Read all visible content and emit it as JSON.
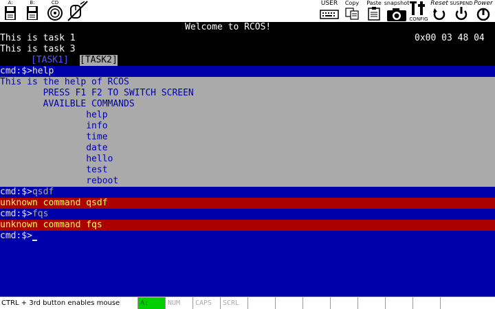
{
  "toolbar": {
    "drive_a_label": "A:",
    "drive_b_label": "B:",
    "cdrom_label": "CD",
    "user_label": "USER",
    "copy_label": "Copy",
    "paste_label": "Paste",
    "snapshot_label": "snapshot",
    "config_label": "CONFIG",
    "reset_label": "Reset",
    "suspend_label": "SUSPEND",
    "power_label": "Power"
  },
  "screen": {
    "title": "Welcome to RCOS!",
    "task1": "This is task 1",
    "task3": "This is task 3",
    "clock": "0x00 03 48 04",
    "tabs": [
      "[TASK1]",
      "[TASK2]"
    ],
    "prompt": "cmd:$>",
    "cmd_help": "help",
    "help_lines": [
      "This is the help of RCOS",
      "        PRESS F1 F2 TO SWITCH SCREEN",
      "        AVAILBLE COMMANDS",
      "                help",
      "                info",
      "                time",
      "                date",
      "                hello",
      "                test",
      "                reboot"
    ],
    "cmd_qsdf": "qsdf",
    "err_qsdf": "unknown command qsdf",
    "cmd_fqs": "fqs",
    "err_fqs": "unknown command fqs"
  },
  "statusbar": {
    "message": "CTRL + 3rd button enables mouse",
    "drive": "A:",
    "num": "NUM",
    "caps": "CAPS",
    "scrl": "SCRL"
  },
  "colors": {
    "console_blue": "#0000aa",
    "help_gray": "#aaaaaa",
    "error_red": "#aa0000",
    "error_yellow": "#ffff55",
    "drive_green": "#00d000"
  }
}
